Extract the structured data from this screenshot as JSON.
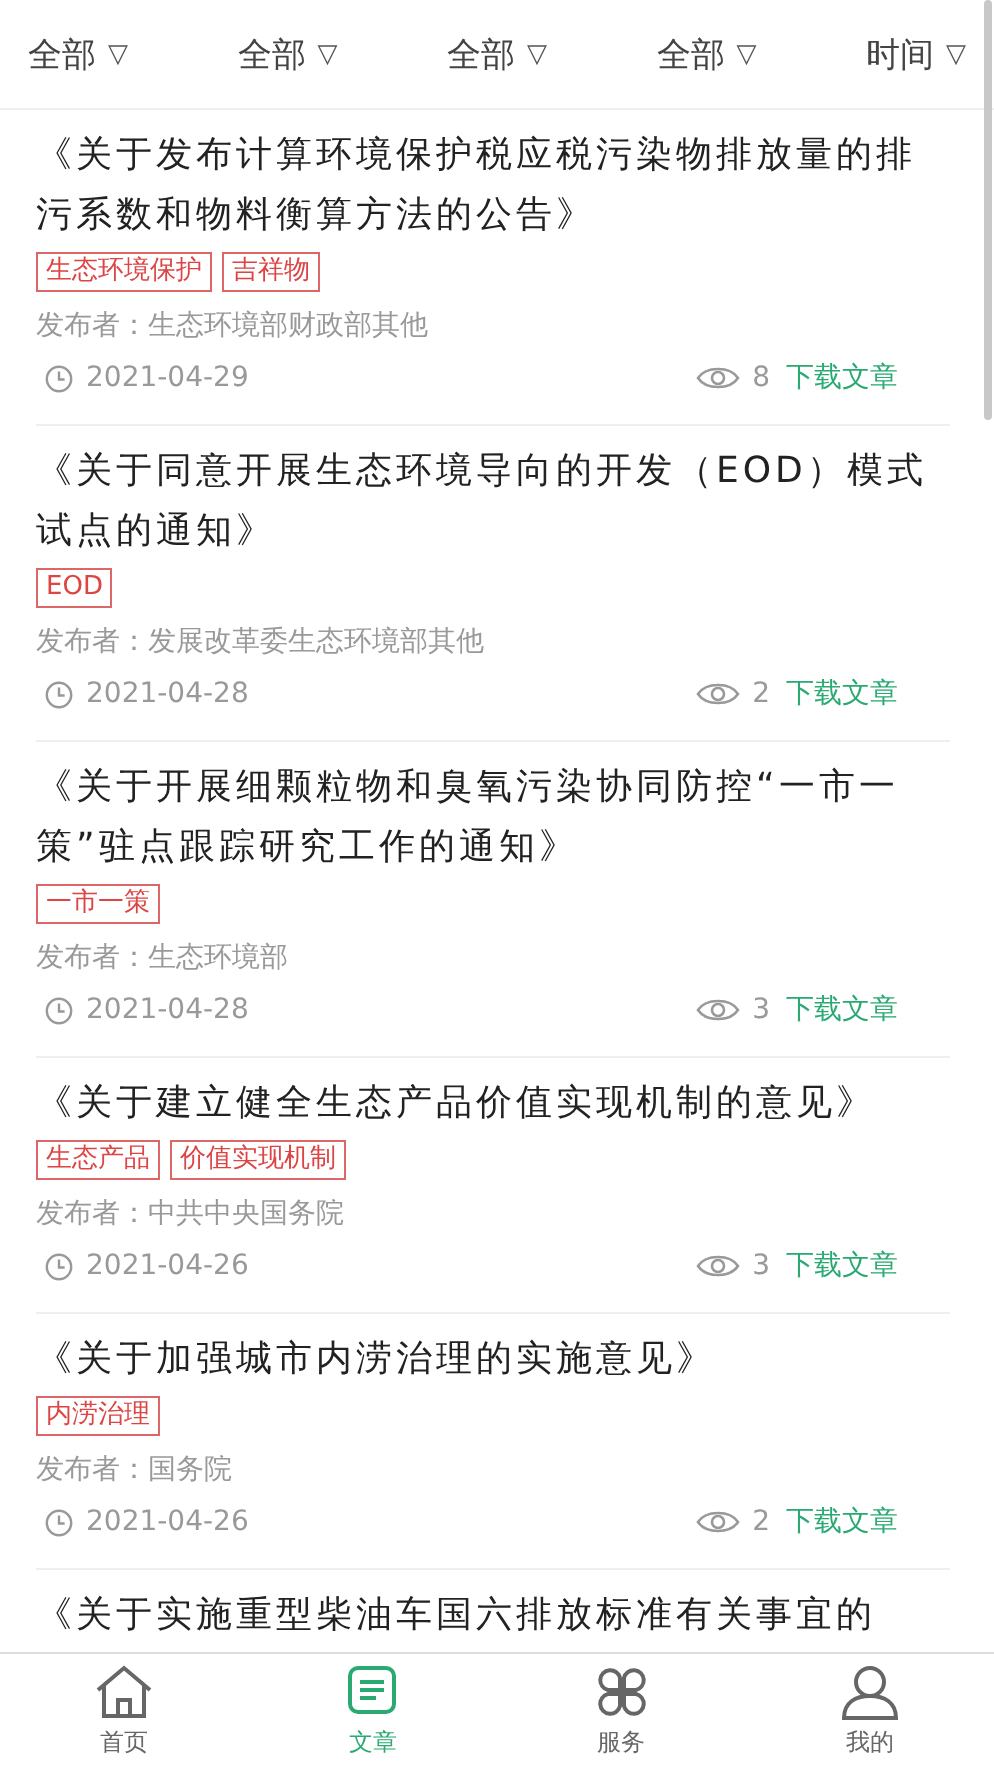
{
  "filters": [
    {
      "label": "全部",
      "icon": "▽"
    },
    {
      "label": "全部",
      "icon": "▽"
    },
    {
      "label": "全部",
      "icon": "▽"
    },
    {
      "label": "全部",
      "icon": "▽"
    },
    {
      "label": "时间",
      "icon": "▽"
    }
  ],
  "articles": [
    {
      "title": "《关于发布计算环境保护税应税污染物排放量的排污系数和物料衡算方法的公告》",
      "tags": [
        "生态环境保护",
        "吉祥物"
      ],
      "publisher": "发布者：生态环境部财政部其他",
      "date": "2021-04-29",
      "views": "8",
      "download": "下载文章"
    },
    {
      "title": "《关于同意开展生态环境导向的开发（EOD）模式试点的通知》",
      "tags": [
        "EOD"
      ],
      "publisher": "发布者：发展改革委生态环境部其他",
      "date": "2021-04-28",
      "views": "2",
      "download": "下载文章"
    },
    {
      "title": "《关于开展细颗粒物和臭氧污染协同防控“一市一策”驻点跟踪研究工作的通知》",
      "tags": [
        "一市一策"
      ],
      "publisher": "发布者：生态环境部",
      "date": "2021-04-28",
      "views": "3",
      "download": "下载文章"
    },
    {
      "title": "《关于建立健全生态产品价值实现机制的意见》",
      "tags": [
        "生态产品",
        "价值实现机制"
      ],
      "publisher": "发布者：中共中央国务院",
      "date": "2021-04-26",
      "views": "3",
      "download": "下载文章"
    },
    {
      "title": "《关于加强城市内涝治理的实施意见》",
      "tags": [
        "内涝治理"
      ],
      "publisher": "发布者：国务院",
      "date": "2021-04-26",
      "views": "2",
      "download": "下载文章"
    },
    {
      "title": "《关于实施重型柴油车国六排放标准有关事宜的"
    }
  ],
  "nav": [
    {
      "label": "首页",
      "kind": "home",
      "selected": false
    },
    {
      "label": "文章",
      "kind": "article",
      "selected": true
    },
    {
      "label": "服务",
      "kind": "service",
      "selected": false
    },
    {
      "label": "我的",
      "kind": "profile",
      "selected": false
    }
  ]
}
